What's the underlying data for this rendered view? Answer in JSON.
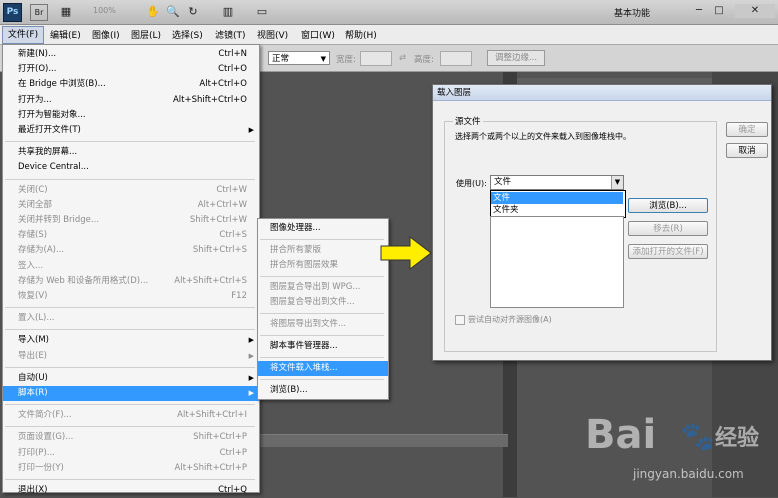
{
  "app": {
    "logo": "Ps",
    "zoom": "100%",
    "workspace": "基本功能",
    "icons": [
      "br-icon",
      "screen-mode-icon",
      "hand-icon",
      "zoom-icon",
      "rotate-icon",
      "arrange-icon",
      "screen-icon"
    ]
  },
  "menubar": [
    "文件(F)",
    "编辑(E)",
    "图像(I)",
    "图层(L)",
    "选择(S)",
    "滤镜(T)",
    "视图(V)",
    "窗口(W)",
    "帮助(H)"
  ],
  "options": {
    "mode": "正常",
    "width_label": "宽度:",
    "height_label": "高度:",
    "refine": "调整边缘..."
  },
  "file_menu": [
    {
      "label": "新建(N)...",
      "shortcut": "Ctrl+N",
      "dis": false
    },
    {
      "label": "打开(O)...",
      "shortcut": "Ctrl+O",
      "dis": false
    },
    {
      "label": "在 Bridge 中浏览(B)...",
      "shortcut": "Alt+Ctrl+O",
      "dis": false
    },
    {
      "label": "打开为...",
      "shortcut": "Alt+Shift+Ctrl+O",
      "dis": false
    },
    {
      "label": "打开为智能对象...",
      "shortcut": "",
      "dis": false
    },
    {
      "label": "最近打开文件(T)",
      "shortcut": "",
      "dis": false,
      "sub": true
    },
    {
      "sep": true
    },
    {
      "label": "共享我的屏幕...",
      "shortcut": "",
      "dis": false
    },
    {
      "label": "Device Central...",
      "shortcut": "",
      "dis": false
    },
    {
      "sep": true
    },
    {
      "label": "关闭(C)",
      "shortcut": "Ctrl+W",
      "dis": true
    },
    {
      "label": "关闭全部",
      "shortcut": "Alt+Ctrl+W",
      "dis": true
    },
    {
      "label": "关闭并转到 Bridge...",
      "shortcut": "Shift+Ctrl+W",
      "dis": true
    },
    {
      "label": "存储(S)",
      "shortcut": "Ctrl+S",
      "dis": true
    },
    {
      "label": "存储为(A)...",
      "shortcut": "Shift+Ctrl+S",
      "dis": true
    },
    {
      "label": "签入...",
      "shortcut": "",
      "dis": true
    },
    {
      "label": "存储为 Web 和设备所用格式(D)...",
      "shortcut": "Alt+Shift+Ctrl+S",
      "dis": true
    },
    {
      "label": "恢复(V)",
      "shortcut": "F12",
      "dis": true
    },
    {
      "sep": true
    },
    {
      "label": "置入(L)...",
      "shortcut": "",
      "dis": true
    },
    {
      "sep": true
    },
    {
      "label": "导入(M)",
      "shortcut": "",
      "dis": false,
      "sub": true
    },
    {
      "label": "导出(E)",
      "shortcut": "",
      "dis": true,
      "sub": true
    },
    {
      "sep": true
    },
    {
      "label": "自动(U)",
      "shortcut": "",
      "dis": false,
      "sub": true
    },
    {
      "label": "脚本(R)",
      "shortcut": "",
      "dis": false,
      "sub": true,
      "hl": true
    },
    {
      "sep": true
    },
    {
      "label": "文件简介(F)...",
      "shortcut": "Alt+Shift+Ctrl+I",
      "dis": true
    },
    {
      "sep": true
    },
    {
      "label": "页面设置(G)...",
      "shortcut": "Shift+Ctrl+P",
      "dis": true
    },
    {
      "label": "打印(P)...",
      "shortcut": "Ctrl+P",
      "dis": true
    },
    {
      "label": "打印一份(Y)",
      "shortcut": "Alt+Shift+Ctrl+P",
      "dis": true
    },
    {
      "sep": true
    },
    {
      "label": "退出(X)",
      "shortcut": "Ctrl+Q",
      "dis": false
    }
  ],
  "script_submenu": [
    {
      "label": "图像处理器...",
      "dis": false
    },
    {
      "sep": true
    },
    {
      "label": "拼合所有蒙版",
      "dis": true
    },
    {
      "label": "拼合所有图层效果",
      "dis": true
    },
    {
      "sep": true
    },
    {
      "label": "图层复合导出到 WPG...",
      "dis": true
    },
    {
      "label": "图层复合导出到文件...",
      "dis": true
    },
    {
      "sep": true
    },
    {
      "label": "将图层导出到文件...",
      "dis": true
    },
    {
      "sep": true
    },
    {
      "label": "脚本事件管理器...",
      "dis": false
    },
    {
      "sep": true
    },
    {
      "label": "将文件载入堆栈...",
      "dis": false,
      "hl": true
    },
    {
      "sep": true
    },
    {
      "label": "浏览(B)...",
      "dis": false
    }
  ],
  "dialog": {
    "title": "载入图层",
    "group": "源文件",
    "instructions": "选择两个或两个以上的文件来载入到图像堆栈中。",
    "use_label": "使用(U):",
    "use_value": "文件",
    "options": [
      "文件",
      "文件夹"
    ],
    "ok": "确定",
    "cancel": "取消",
    "browse": "浏览(B)...",
    "remove": "移去(R)",
    "add_open": "添加打开的文件(F)",
    "auto_align": "尝试自动对齐源图像(A)"
  },
  "watermark": {
    "brand": "Bai",
    "brand2": "经验",
    "url": "jingyan.baidu.com"
  },
  "colors": {
    "highlight": "#3399ff",
    "arrow": "#ffee00"
  }
}
